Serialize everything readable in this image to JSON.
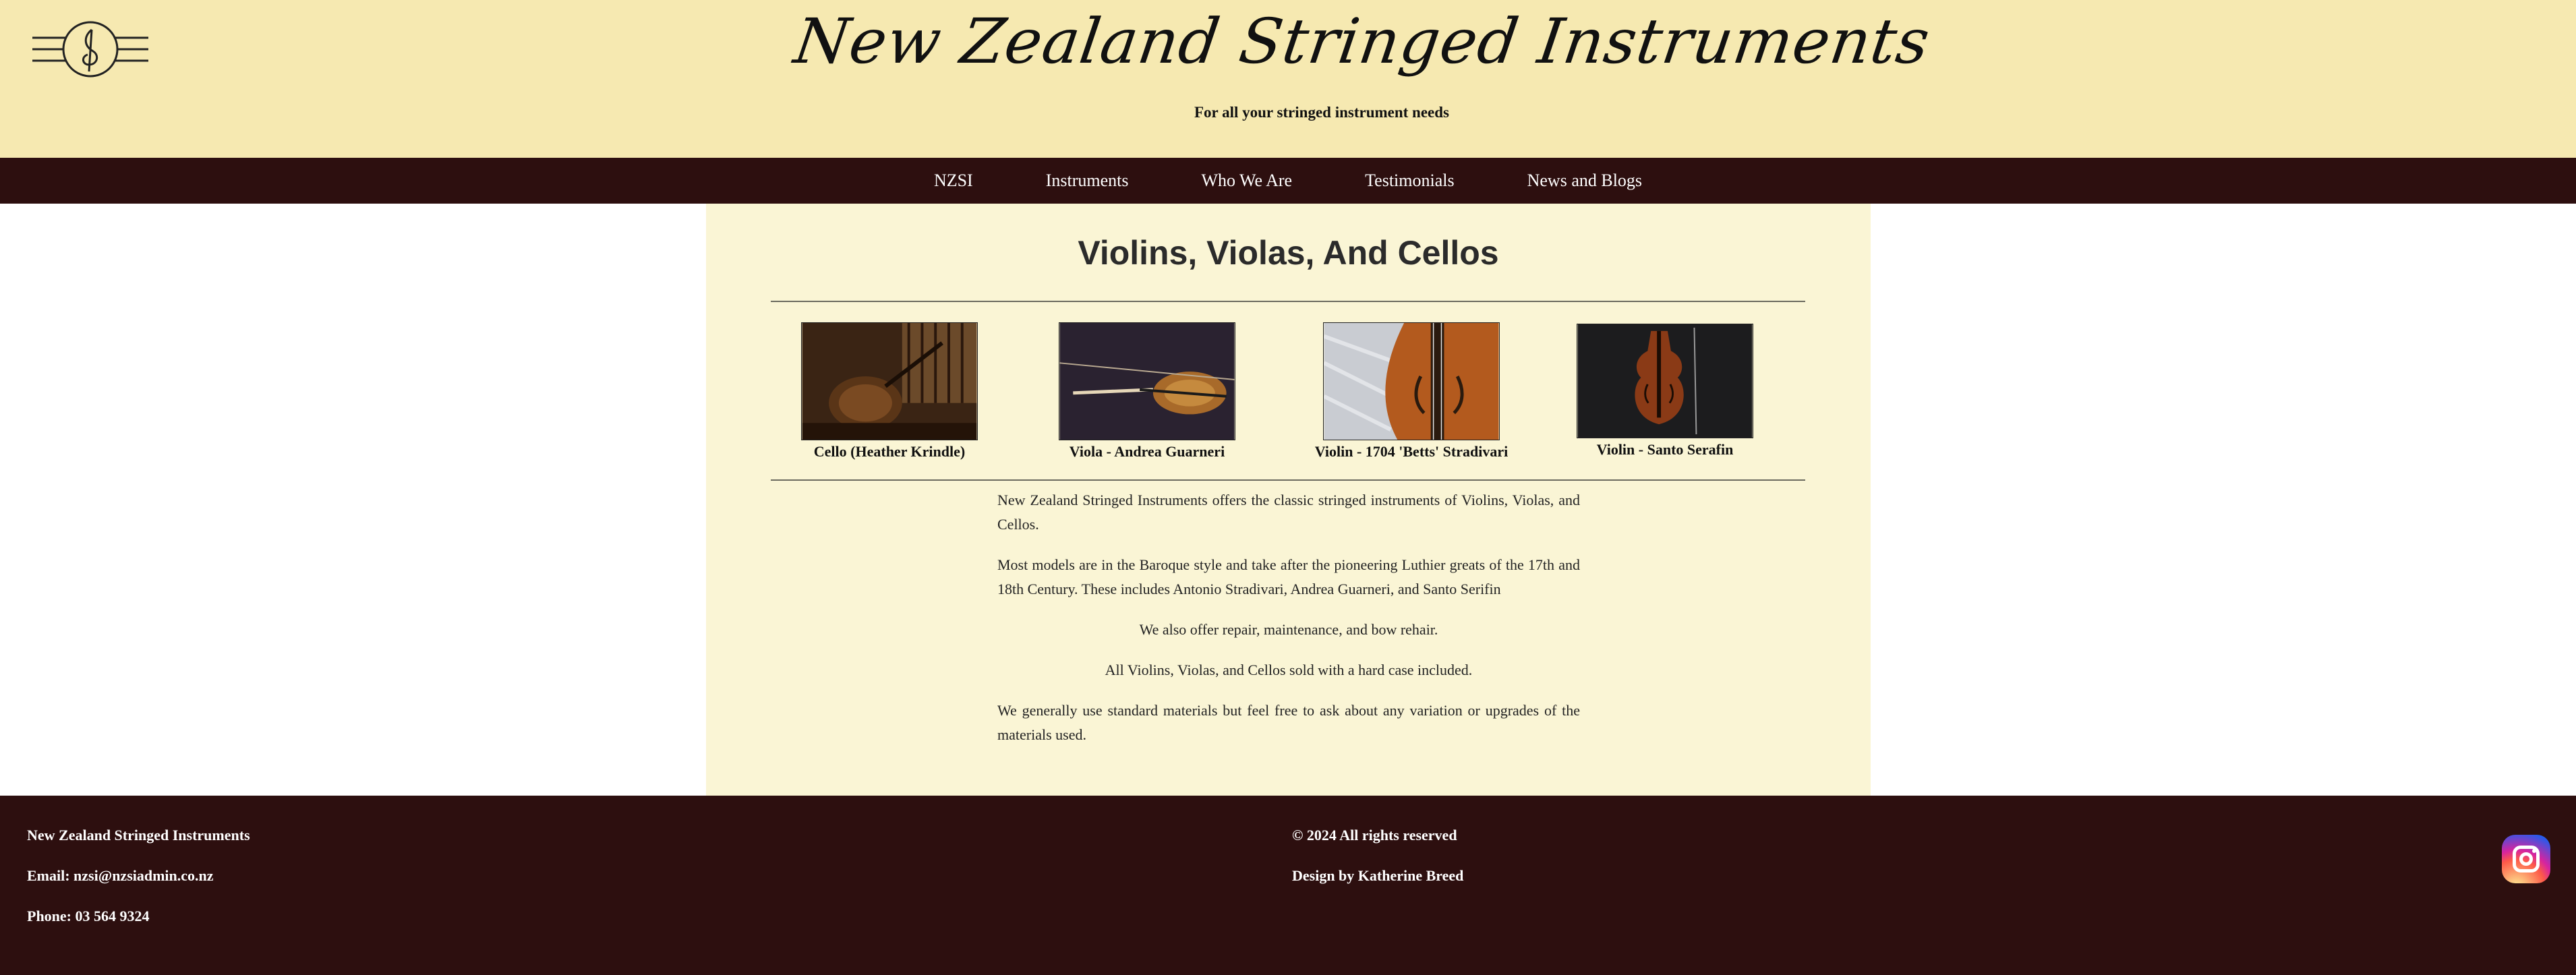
{
  "header": {
    "site_title": "New Zealand Stringed Instruments",
    "tagline": "For all your stringed instrument needs",
    "logo_icon": "treble-clef-logo-icon"
  },
  "nav": {
    "items": [
      {
        "label": "NZSI"
      },
      {
        "label": "Instruments"
      },
      {
        "label": "Who We Are"
      },
      {
        "label": "Testimonials"
      },
      {
        "label": "News and Blogs"
      }
    ]
  },
  "main": {
    "title": "Violins, Violas, And Cellos",
    "gallery": [
      {
        "caption": "Cello (Heather Krindle)",
        "image": "cello-photo"
      },
      {
        "caption": "Viola - Andrea Guarneri",
        "image": "viola-photo"
      },
      {
        "caption": "Violin - 1704 'Betts' Stradivari",
        "image": "violin-stradivari-photo"
      },
      {
        "caption": "Violin - Santo Serafin",
        "image": "violin-serafin-photo"
      }
    ],
    "paragraphs": [
      "New Zealand Stringed Instruments offers the classic stringed instruments of Violins, Violas, and Cellos.",
      "Most models are in the Baroque style and take after the pioneering Luthier greats of the 17th and 18th Century. These includes Antonio Stradivari, Andrea Guarneri, and Santo Serifin",
      "We also offer repair, maintenance, and bow rehair.",
      "All Violins, Violas, and Cellos sold with a hard case included.",
      "We generally use standard materials but feel free to ask about any variation or upgrades of the materials used."
    ]
  },
  "footer": {
    "company": "New Zealand Stringed Instruments",
    "email": "Email: nzsi@nzsiadmin.co.nz",
    "phone": "Phone: 03 564 9324",
    "copyright": "© 2024 All rights reserved",
    "design_credit": "Design by Katherine Breed",
    "social_icon": "instagram-icon"
  },
  "colors": {
    "header_bg": "#f6e9b1",
    "nav_bg": "#2d0f0f",
    "content_bg": "#faf5d5",
    "footer_bg": "#2d0f0f"
  }
}
